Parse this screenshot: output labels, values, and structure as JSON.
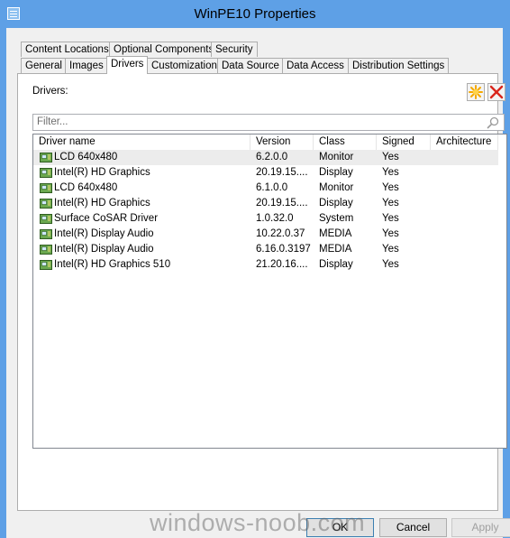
{
  "window": {
    "title": "WinPE10 Properties",
    "title_icon": "properties-icon"
  },
  "tabs_row1": [
    "Content Locations",
    "Optional Components",
    "Security"
  ],
  "tabs_row2": [
    "General",
    "Images",
    "Drivers",
    "Customization",
    "Data Source",
    "Data Access",
    "Distribution Settings"
  ],
  "active_tab": "Drivers",
  "drivers": {
    "label": "Drivers:",
    "filter_placeholder": "Filter...",
    "columns": [
      "Driver name",
      "Version",
      "Class",
      "Signed",
      "Architecture"
    ],
    "rows": [
      {
        "name": "LCD 640x480",
        "version": "6.2.0.0",
        "class": "Monitor",
        "signed": "Yes",
        "architecture": ""
      },
      {
        "name": "Intel(R) HD Graphics",
        "version": "20.19.15....",
        "class": "Display",
        "signed": "Yes",
        "architecture": ""
      },
      {
        "name": "LCD 640x480",
        "version": "6.1.0.0",
        "class": "Monitor",
        "signed": "Yes",
        "architecture": ""
      },
      {
        "name": "Intel(R) HD Graphics",
        "version": "20.19.15....",
        "class": "Display",
        "signed": "Yes",
        "architecture": ""
      },
      {
        "name": "Surface CoSAR Driver",
        "version": "1.0.32.0",
        "class": "System",
        "signed": "Yes",
        "architecture": ""
      },
      {
        "name": "Intel(R) Display Audio",
        "version": "10.22.0.37",
        "class": "MEDIA",
        "signed": "Yes",
        "architecture": ""
      },
      {
        "name": "Intel(R) Display Audio",
        "version": "6.16.0.3197",
        "class": "MEDIA",
        "signed": "Yes",
        "architecture": ""
      },
      {
        "name": "Intel(R) HD Graphics 510",
        "version": "21.20.16....",
        "class": "Display",
        "signed": "Yes",
        "architecture": ""
      }
    ],
    "selected_row": 0,
    "row_icon": "driver-icon",
    "add_icon": "new-star-icon",
    "remove_icon": "delete-x-icon"
  },
  "buttons": {
    "ok": "OK",
    "cancel": "Cancel",
    "apply": "Apply"
  },
  "watermark": "windows-noob.com",
  "colors": {
    "title_bar": "#5ea0e6",
    "dialog_bg": "#f0f0f0",
    "selected_row": "#ececec",
    "remove_red": "#d9261c",
    "add_orange": "#f5a800"
  }
}
